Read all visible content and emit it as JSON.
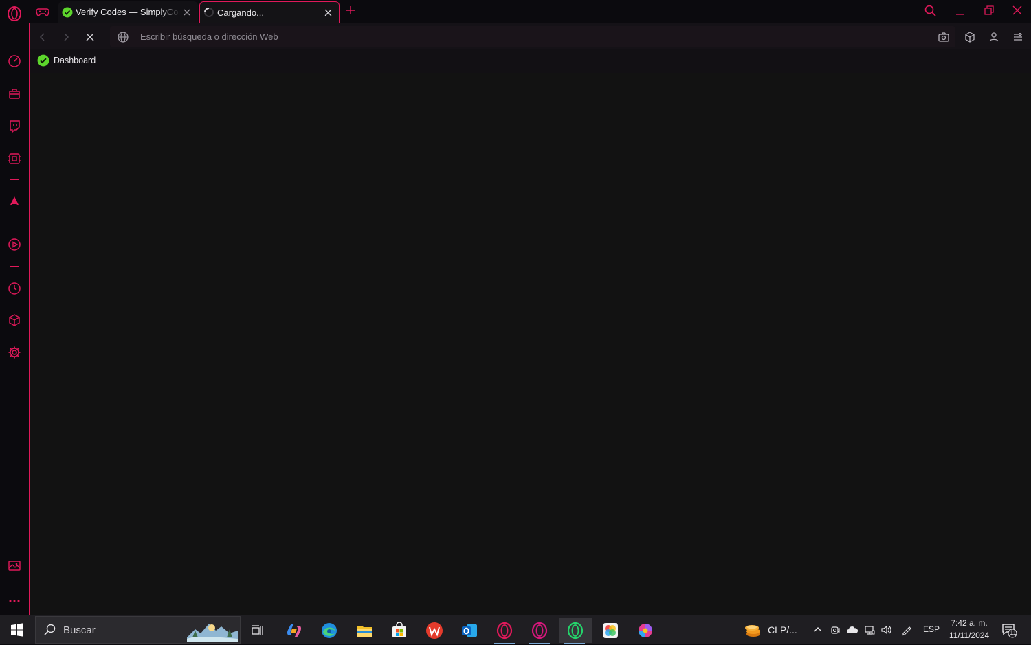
{
  "tabs": [
    {
      "title": "Verify Codes — SimplyCodes",
      "icon": "simplycodes-icon"
    },
    {
      "title": "Cargando...",
      "icon": "loading-spinner-icon"
    }
  ],
  "address_bar": {
    "placeholder": "Escribir búsqueda o dirección Web"
  },
  "bookmarks": [
    {
      "label": "Dashboard"
    }
  ],
  "taskbar": {
    "search_label": "Buscar",
    "weather_label": "CLP/...",
    "language": "ESP",
    "time": "7:42 a. m.",
    "date": "11/11/2024",
    "notification_count": "11"
  },
  "colors": {
    "accent": "#e0195a",
    "simplycodes_green": "#5dd62c",
    "background": "#121212"
  }
}
